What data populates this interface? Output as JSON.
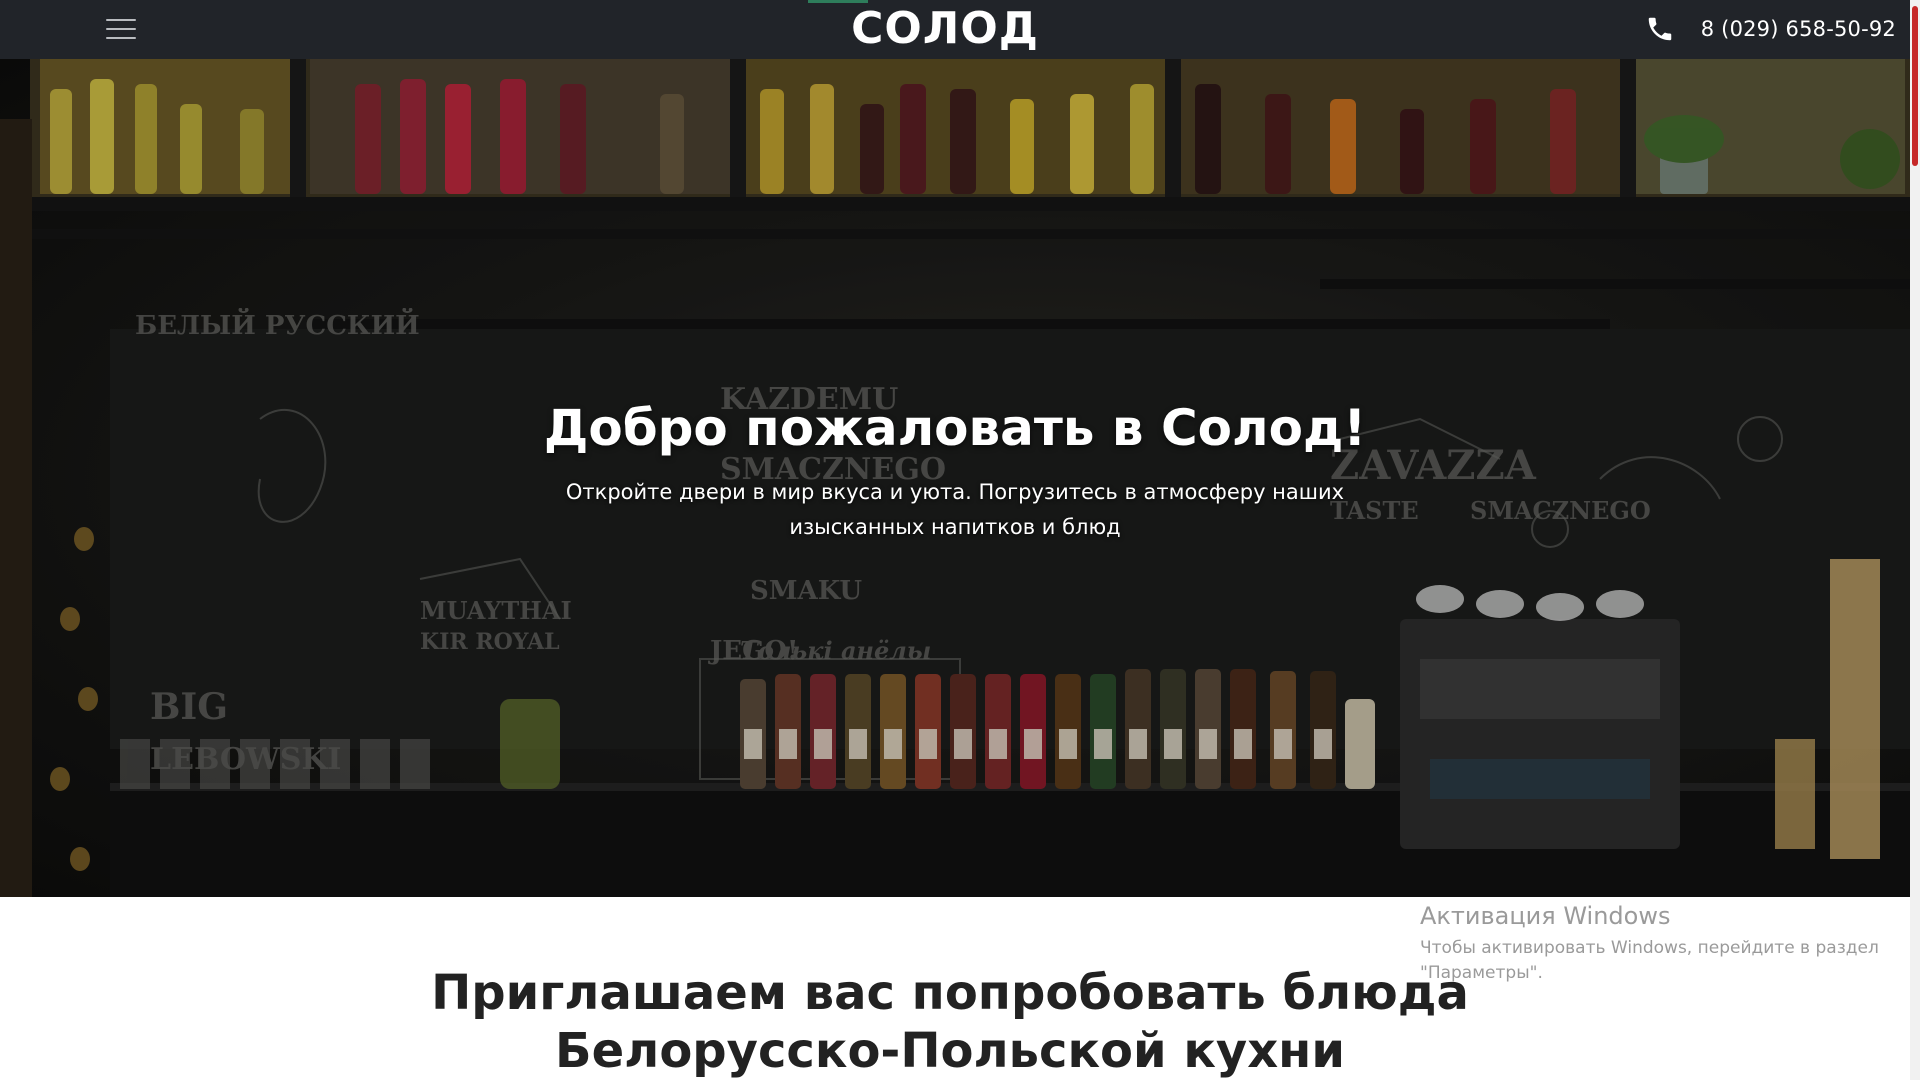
{
  "header": {
    "menu_icon": "hamburger-menu-icon",
    "logo": "СОЛОД",
    "phone_icon": "phone-icon",
    "phone": "8 (029) 658-50-92"
  },
  "hero": {
    "title": "Добро пожаловать в Солод!",
    "subtitle": "Откройте двери в мир вкуса и уюта. Погрузитесь в атмосферу наших изысканных напитков и блюд"
  },
  "section": {
    "title": "Приглашаем вас попробовать блюда Белорусско-Польской кухни"
  },
  "windows_activation": {
    "title": "Активация Windows",
    "text": "Чтобы активировать Windows, перейдите в раздел \"Параметры\"."
  },
  "colors": {
    "header_bg": "#212429",
    "scroll_thumb": "#c62828"
  }
}
